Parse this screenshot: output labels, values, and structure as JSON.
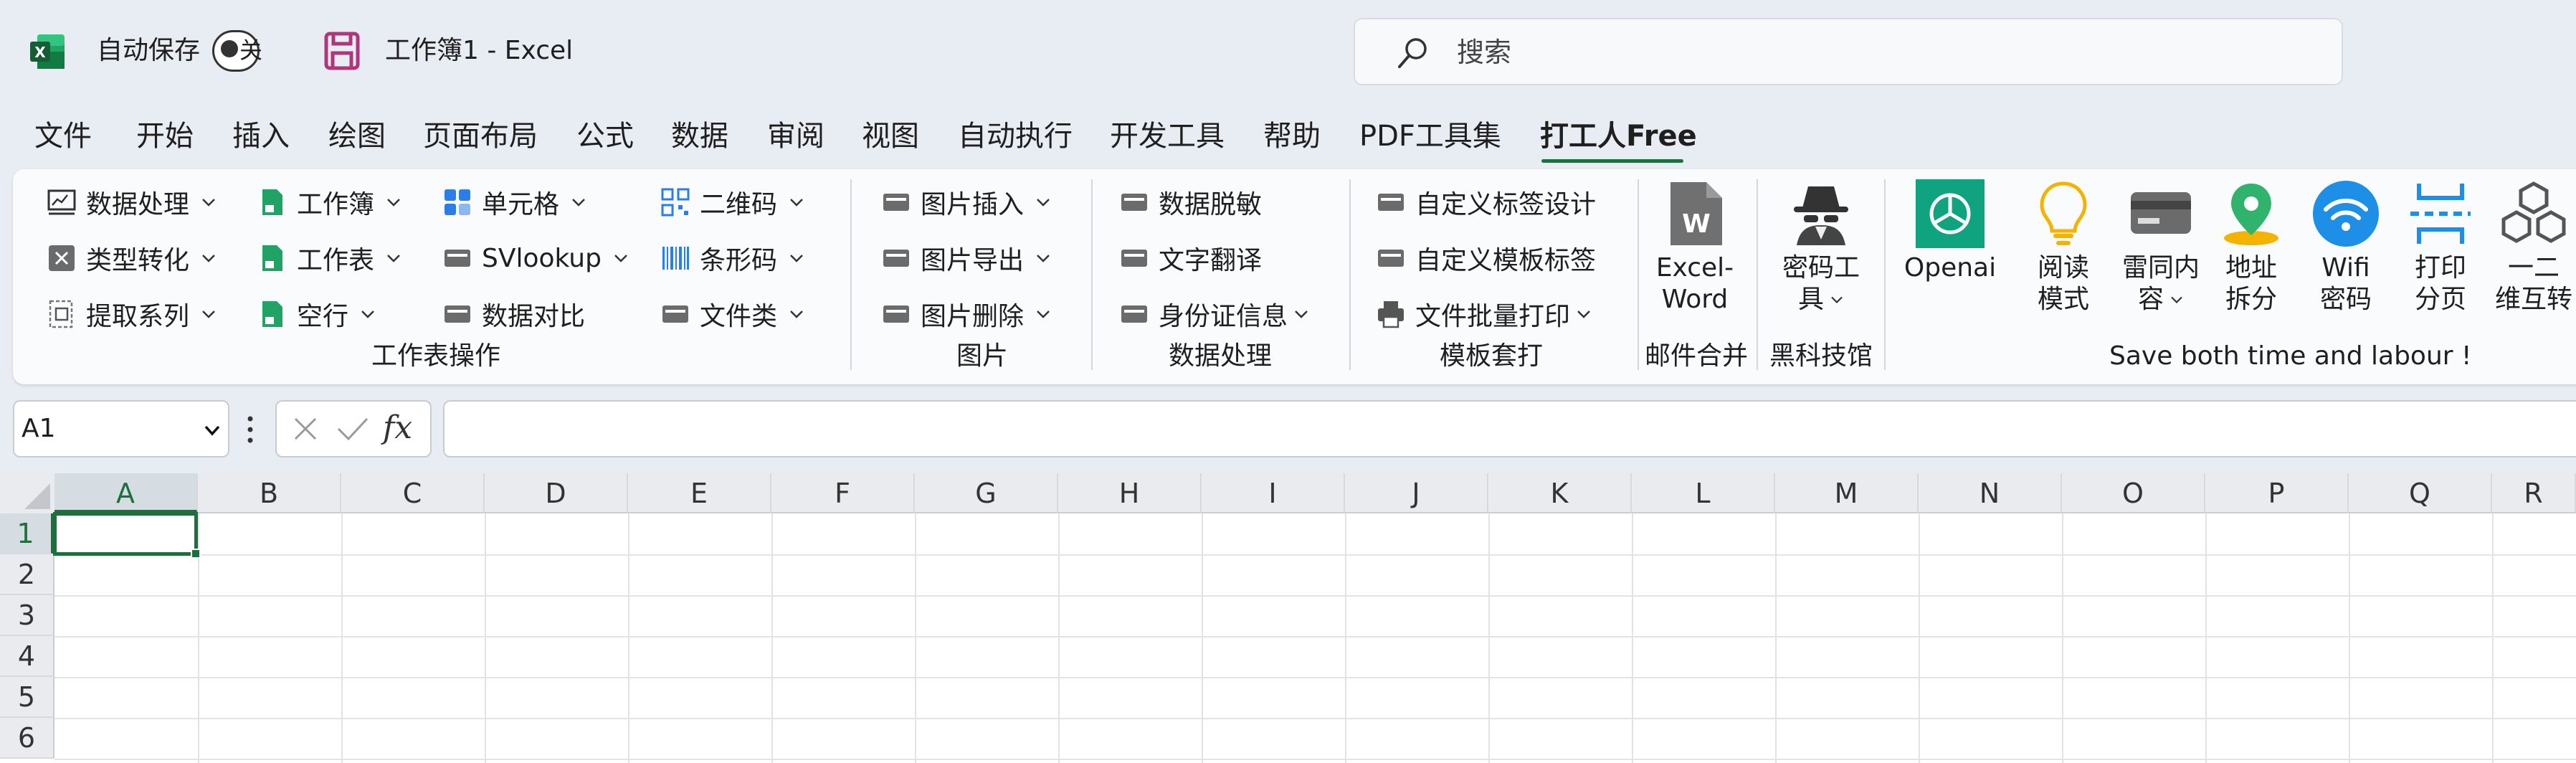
{
  "titlebar": {
    "autosave_label": "自动保存",
    "autosave_state": "关",
    "doc_title": "工作簿1  -  Excel",
    "search_placeholder": "搜索"
  },
  "tabs": [
    "文件",
    "开始",
    "插入",
    "绘图",
    "页面布局",
    "公式",
    "数据",
    "审阅",
    "视图",
    "自动执行",
    "开发工具",
    "帮助",
    "PDF工具集",
    "打工人Free"
  ],
  "active_tab": "打工人Free",
  "ribbon": {
    "worksheet_ops": {
      "label": "工作表操作",
      "items": [
        "数据处理",
        "类型转化",
        "提取系列",
        "工作簿",
        "工作表",
        "空行",
        "单元格",
        "SVlookup",
        "数据对比",
        "二维码",
        "条形码",
        "文件类"
      ]
    },
    "picture": {
      "label": "图片",
      "items": [
        "图片插入",
        "图片导出",
        "图片删除"
      ]
    },
    "data_processing": {
      "label": "数据处理",
      "items": [
        "数据脱敏",
        "文字翻译",
        "身份证信息"
      ]
    },
    "template": {
      "label": "模板套打",
      "items": [
        "自定义标签设计",
        "自定义模板标签",
        "文件批量打印"
      ]
    },
    "mail_merge": {
      "label": "邮件合并",
      "button_line1": "Excel-",
      "button_line2": "Word"
    },
    "black_tech": {
      "label": "黑科技馆",
      "button_line1": "密码工",
      "button_line2": "具"
    },
    "tools": {
      "label": "Save both time and labour !",
      "openai": "Openai",
      "read_1": "阅读",
      "read_2": "模式",
      "thunder_1": "雷同内",
      "thunder_2": "容",
      "addr_1": "地址",
      "addr_2": "拆分",
      "wifi_1": "Wifi",
      "wifi_2": "密码",
      "print_1": "打印",
      "print_2": "分页",
      "qr_1": "一二",
      "qr_2": "维互转"
    }
  },
  "formula_bar": {
    "name_box": "A1",
    "fx": "fx",
    "formula": ""
  },
  "grid": {
    "columns": [
      "A",
      "B",
      "C",
      "D",
      "E",
      "F",
      "G",
      "H",
      "I",
      "J",
      "K",
      "L",
      "M",
      "N",
      "O",
      "P",
      "Q",
      "R"
    ],
    "rows": [
      "1",
      "2",
      "3",
      "4",
      "5",
      "6"
    ],
    "selected_cell": "A1"
  },
  "colors": {
    "excel_green": "#1d6f3d",
    "accent_purple": "#b1357a"
  }
}
